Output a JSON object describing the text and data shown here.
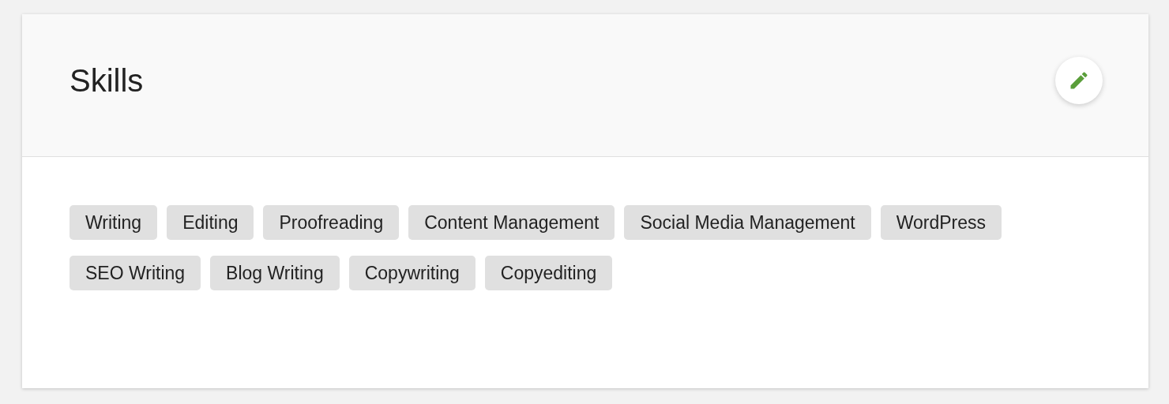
{
  "card": {
    "title": "Skills",
    "tags": [
      "Writing",
      "Editing",
      "Proofreading",
      "Content Management",
      "Social Media Management",
      "WordPress",
      "SEO Writing",
      "Blog Writing",
      "Copywriting",
      "Copyediting"
    ]
  }
}
